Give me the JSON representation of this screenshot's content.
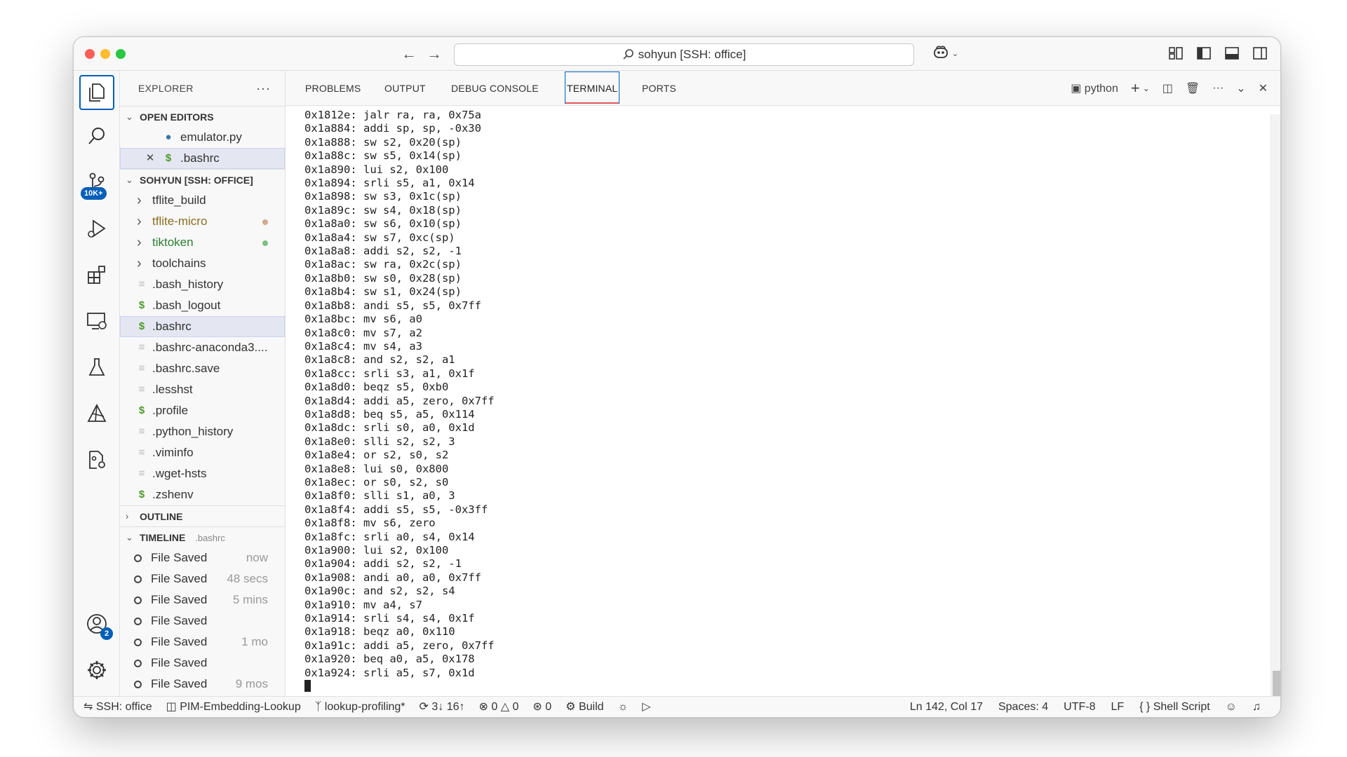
{
  "title": "sohyun [SSH: office]",
  "explorer": {
    "header": "EXPLORER",
    "open_editors": {
      "title": "OPEN EDITORS",
      "files": [
        {
          "name": "emulator.py"
        },
        {
          "name": ".bashrc"
        }
      ]
    },
    "workspace": {
      "title": "SOHYUN [SSH: OFFICE]",
      "items": [
        {
          "name": "tflite_build",
          "type": "folder"
        },
        {
          "name": "tflite-micro",
          "type": "folder",
          "color": "#8a6d1e",
          "dot": "#d4a98c"
        },
        {
          "name": "tiktoken",
          "type": "folder",
          "color": "#2e7d32",
          "dot": "#7fbf7f"
        },
        {
          "name": "toolchains",
          "type": "folder"
        },
        {
          "name": ".bash_history",
          "type": "text"
        },
        {
          "name": ".bash_logout",
          "type": "shell"
        },
        {
          "name": ".bashrc",
          "type": "shell",
          "selected": true
        },
        {
          "name": ".bashrc-anaconda3....",
          "type": "text"
        },
        {
          "name": ".bashrc.save",
          "type": "text"
        },
        {
          "name": ".lesshst",
          "type": "text"
        },
        {
          "name": ".profile",
          "type": "shell"
        },
        {
          "name": ".python_history",
          "type": "text"
        },
        {
          "name": ".viminfo",
          "type": "text"
        },
        {
          "name": ".wget-hsts",
          "type": "text"
        },
        {
          "name": ".zshenv",
          "type": "shell"
        }
      ]
    },
    "outline": {
      "title": "OUTLINE"
    },
    "timeline": {
      "title": "TIMELINE",
      "file": ".bashrc",
      "entries": [
        {
          "label": "File Saved",
          "time": "now"
        },
        {
          "label": "File Saved",
          "time": "48 secs"
        },
        {
          "label": "File Saved",
          "time": "5 mins"
        },
        {
          "label": "File Saved",
          "time": ""
        },
        {
          "label": "File Saved",
          "time": "1 mo"
        },
        {
          "label": "File Saved",
          "time": ""
        },
        {
          "label": "File Saved",
          "time": "9 mos"
        }
      ]
    }
  },
  "activity": {
    "scm_badge": "10K+",
    "accounts_badge": "2"
  },
  "panel": {
    "tabs": [
      "PROBLEMS",
      "OUTPUT",
      "DEBUG CONSOLE",
      "TERMINAL",
      "PORTS"
    ],
    "active_tab": "TERMINAL",
    "terminal_profile": "python"
  },
  "terminal_lines": [
    "0x1812e: jalr ra, ra, 0x75a",
    "0x1a884: addi sp, sp, -0x30",
    "0x1a888: sw s2, 0x20(sp)",
    "0x1a88c: sw s5, 0x14(sp)",
    "0x1a890: lui s2, 0x100",
    "0x1a894: srli s5, a1, 0x14",
    "0x1a898: sw s3, 0x1c(sp)",
    "0x1a89c: sw s4, 0x18(sp)",
    "0x1a8a0: sw s6, 0x10(sp)",
    "0x1a8a4: sw s7, 0xc(sp)",
    "0x1a8a8: addi s2, s2, -1",
    "0x1a8ac: sw ra, 0x2c(sp)",
    "0x1a8b0: sw s0, 0x28(sp)",
    "0x1a8b4: sw s1, 0x24(sp)",
    "0x1a8b8: andi s5, s5, 0x7ff",
    "0x1a8bc: mv s6, a0",
    "0x1a8c0: mv s7, a2",
    "0x1a8c4: mv s4, a3",
    "0x1a8c8: and s2, s2, a1",
    "0x1a8cc: srli s3, a1, 0x1f",
    "0x1a8d0: beqz s5, 0xb0",
    "0x1a8d4: addi a5, zero, 0x7ff",
    "0x1a8d8: beq s5, a5, 0x114",
    "0x1a8dc: srli s0, a0, 0x1d",
    "0x1a8e0: slli s2, s2, 3",
    "0x1a8e4: or s2, s0, s2",
    "0x1a8e8: lui s0, 0x800",
    "0x1a8ec: or s0, s2, s0",
    "0x1a8f0: slli s1, a0, 3",
    "0x1a8f4: addi s5, s5, -0x3ff",
    "0x1a8f8: mv s6, zero",
    "0x1a8fc: srli a0, s4, 0x14",
    "0x1a900: lui s2, 0x100",
    "0x1a904: addi s2, s2, -1",
    "0x1a908: andi a0, a0, 0x7ff",
    "0x1a90c: and s2, s2, s4",
    "0x1a910: mv a4, s7",
    "0x1a914: srli s4, s4, 0x1f",
    "0x1a918: beqz a0, 0x110",
    "0x1a91c: addi a5, zero, 0x7ff",
    "0x1a920: beq a0, a5, 0x178",
    "0x1a924: srli a5, s7, 0x1d"
  ],
  "status": {
    "remote": "SSH: office",
    "project": "PIM-Embedding-Lookup",
    "branch": "lookup-profiling*",
    "sync": "3↓ 16↑",
    "errors": "0",
    "warnings": "0",
    "ports": "0",
    "build": "Build",
    "position": "Ln 142, Col 17",
    "spaces": "Spaces: 4",
    "encoding": "UTF-8",
    "eol": "LF",
    "language": "Shell Script"
  }
}
